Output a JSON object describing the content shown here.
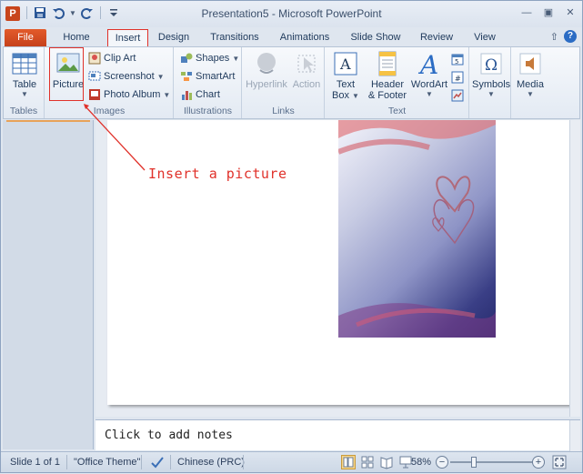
{
  "window": {
    "title": "Presentation5  -  Microsoft PowerPoint",
    "app_icon_letter": "P"
  },
  "qat": {
    "icons": [
      "save-icon",
      "undo-icon",
      "redo-icon",
      "customize-icon"
    ]
  },
  "tabs": {
    "file": "File",
    "home": "Home",
    "insert": "Insert",
    "design": "Design",
    "transitions": "Transitions",
    "animations": "Animations",
    "slide_show": "Slide Show",
    "review": "Review",
    "view": "View"
  },
  "ribbon": {
    "tables": {
      "label": "Tables",
      "table": "Table"
    },
    "images": {
      "label": "Images",
      "picture": "Picture",
      "clip_art": "Clip Art",
      "screenshot": "Screenshot",
      "photo_album": "Photo Album"
    },
    "illustrations": {
      "label": "Illustrations",
      "shapes": "Shapes",
      "smartart": "SmartArt",
      "chart": "Chart"
    },
    "links": {
      "label": "Links",
      "hyperlink": "Hyperlink",
      "action": "Action"
    },
    "text": {
      "label": "Text",
      "text_box_line1": "Text",
      "text_box_line2": "Box",
      "header_footer_line1": "Header",
      "header_footer_line2": "& Footer",
      "wordart": "WordArt"
    },
    "symbols": "Symbols",
    "media": "Media"
  },
  "annotation": {
    "text": "Insert a picture",
    "color": "#e0312a"
  },
  "notes": {
    "placeholder": "Click to add notes"
  },
  "status": {
    "slide": "Slide 1 of 1",
    "theme": "\"Office Theme\"",
    "language": "Chinese (PRC)",
    "zoom": "58%"
  },
  "colors": {
    "file_tab": "#c4401a",
    "accent_red": "#e0312a",
    "ribbon_text": "#1e395b"
  }
}
